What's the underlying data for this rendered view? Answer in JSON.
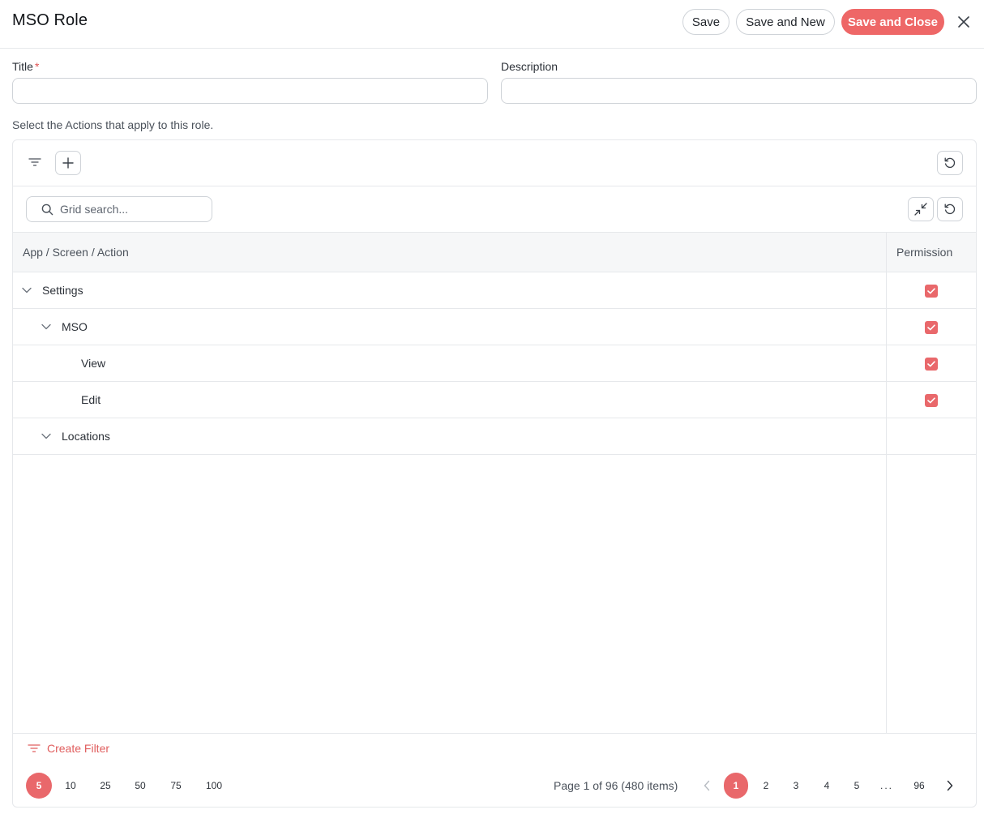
{
  "header": {
    "title": "MSO Role",
    "save_label": "Save",
    "save_new_label": "Save and New",
    "save_close_label": "Save and Close",
    "close_icon": "close-icon"
  },
  "form": {
    "title_label": "Title",
    "required_mark": "*",
    "title_value": "",
    "description_label": "Description",
    "description_value": ""
  },
  "helper_text": "Select the Actions that apply to this role.",
  "grid": {
    "search_placeholder": "Grid search...",
    "columns": {
      "name": "App / Screen / Action",
      "permission": "Permission"
    },
    "rows": [
      {
        "label": "Settings",
        "level": 0,
        "expandable": true,
        "checked": true
      },
      {
        "label": "MSO",
        "level": 1,
        "expandable": true,
        "checked": true
      },
      {
        "label": "View",
        "level": 2,
        "expandable": false,
        "checked": true
      },
      {
        "label": "Edit",
        "level": 2,
        "expandable": false,
        "checked": true
      },
      {
        "label": "Locations",
        "level": 1,
        "expandable": true,
        "checked": false
      }
    ],
    "create_filter_label": "Create Filter",
    "page_sizes": [
      "5",
      "10",
      "25",
      "50",
      "75",
      "100"
    ],
    "active_page_size": "5",
    "page_info": "Page 1 of 96 (480 items)",
    "pages": [
      "1",
      "2",
      "3",
      "4",
      "5",
      "...",
      "96"
    ],
    "active_page": "1"
  },
  "colors": {
    "accent": "#e9686b",
    "border": "#e6e8eb"
  }
}
